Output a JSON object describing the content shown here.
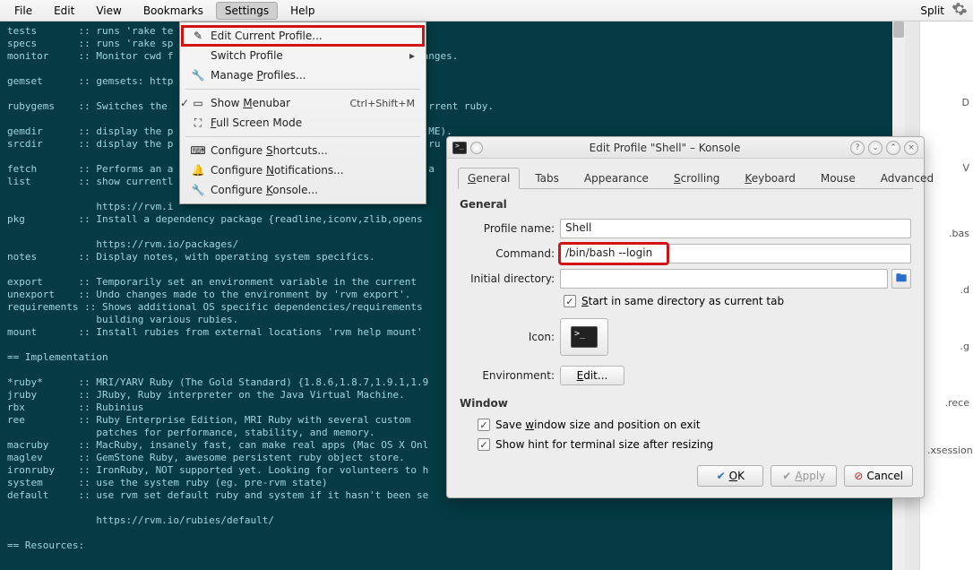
{
  "menubar": {
    "items": [
      "File",
      "Edit",
      "View",
      "Bookmarks",
      "Settings",
      "Help"
    ],
    "split": "Split"
  },
  "dropdown": {
    "edit_current_profile": "Edit Current Profile...",
    "switch_profile": "Switch Profile",
    "manage_profiles": "Manage Profiles...",
    "show_menubar": "Show Menubar",
    "show_menubar_shortcut": "Ctrl+Shift+M",
    "full_screen": "Full Screen Mode",
    "conf_shortcuts": "Configure Shortcuts...",
    "conf_notifications": "Configure Notifications...",
    "conf_konsole": "Configure Konsole..."
  },
  "terminal_text": "tests       :: runs 'rake te\nspecs       :: runs 'rake sp\nmonitor     :: Monitor cwd f                                          anges.\n\ngemset      :: gemsets: http\n\nrubygems    :: Switches the                                            rrent ruby.\n\ngemdir      :: display the p                                           ME).\nsrcdir      :: display the p                                           ru\n\nfetch       :: Performs an a                                           a\nlist        :: show currentl\n\n               https://rvm.i\npkg         :: Install a dependency package {readline,iconv,zlib,opens\n\n               https://rvm.io/packages/\nnotes       :: Display notes, with operating system specifics.\n\nexport      :: Temporarily set an environment variable in the current \nunexport    :: Undo changes made to the environment by 'rvm export'.\nrequirements :: Shows additional OS specific dependencies/requirements \n               building various rubies.\nmount       :: Install rubies from external locations 'rvm help mount'\n\n== Implementation\n\n*ruby*      :: MRI/YARV Ruby (The Gold Standard) {1.8.6,1.8.7,1.9.1,1.9\njruby       :: JRuby, Ruby interpreter on the Java Virtual Machine.\nrbx         :: Rubinius\nree         :: Ruby Enterprise Edition, MRI Ruby with several custom\n               patches for performance, stability, and memory.\nmacruby     :: MacRuby, insanely fast, can make real apps (Mac OS X Onl\nmaglev      :: GemStone Ruby, awesome persistent ruby object store.\nironruby    :: IronRuby, NOT supported yet. Looking for volunteers to h\nsystem      :: use the system ruby (eg. pre-rvm state)\ndefault     :: use rvm set default ruby and system if it hasn't been se\n\n               https://rvm.io/rubies/default/\n\n== Resources:",
  "side": {
    "items": [
      "D",
      "V",
      ".bas",
      ".d",
      ".g",
      ".rece",
      ".xsession"
    ]
  },
  "dialog": {
    "title": "Edit Profile \"Shell\" – Konsole",
    "tabs": {
      "general": "General",
      "tabs": "Tabs",
      "appearance": "Appearance",
      "scrolling": "Scrolling",
      "keyboard": "Keyboard",
      "mouse": "Mouse",
      "advanced": "Advanced"
    },
    "section_general": "General",
    "labels": {
      "profile_name": "Profile name:",
      "command": "Command:",
      "initial_dir": "Initial directory:",
      "icon": "Icon:",
      "environment": "Environment:"
    },
    "values": {
      "profile_name": "Shell",
      "command": "/bin/bash --login",
      "initial_dir": ""
    },
    "start_same_dir": "Start in same directory as current tab",
    "section_window": "Window",
    "save_size": "Save window size and position on exit",
    "show_hint": "Show hint for terminal size after resizing",
    "edit": "Edit...",
    "ok": "OK",
    "apply": "Apply",
    "cancel": "Cancel"
  }
}
